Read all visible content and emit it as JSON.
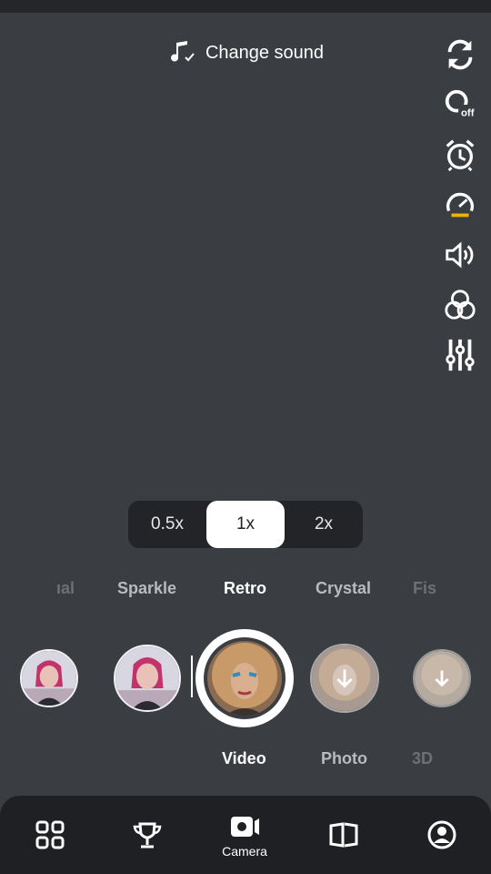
{
  "sound": {
    "label": "Change sound",
    "icon": "music-note-check-icon"
  },
  "right_toolbar": [
    {
      "name": "flip-camera-icon"
    },
    {
      "name": "zoom-off-icon",
      "text": "off"
    },
    {
      "name": "timer-icon"
    },
    {
      "name": "speed-icon"
    },
    {
      "name": "volume-icon"
    },
    {
      "name": "color-filter-icon"
    },
    {
      "name": "adjust-sliders-icon"
    }
  ],
  "zoom": {
    "options": [
      "0.5x",
      "1x",
      "2x"
    ],
    "selected": "1x"
  },
  "filters": {
    "items": [
      "ıal",
      "Sparkle",
      "Retro",
      "Crystal",
      "Fis"
    ],
    "selected": "Retro"
  },
  "modes": {
    "items": [
      "Video",
      "Photo",
      "3D"
    ],
    "selected": "Video"
  },
  "bottom_nav": {
    "items": [
      {
        "name": "apps-icon"
      },
      {
        "name": "trophy-icon"
      },
      {
        "name": "camera-icon",
        "label": "Camera"
      },
      {
        "name": "cards-icon"
      },
      {
        "name": "profile-icon"
      }
    ]
  },
  "colors": {
    "background": "#3a3d42",
    "nav_bg": "#1f2023",
    "accent": "#f0b400"
  }
}
